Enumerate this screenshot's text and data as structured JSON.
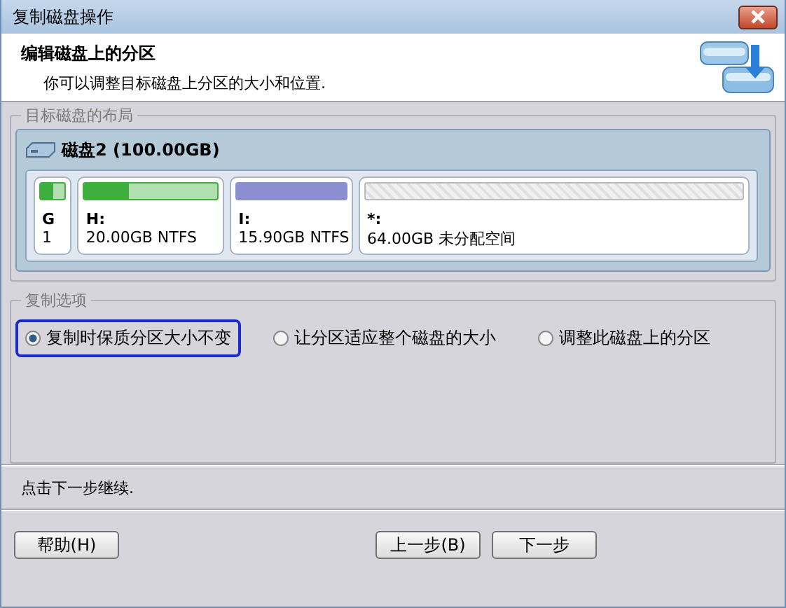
{
  "window": {
    "title": "复制磁盘操作"
  },
  "header": {
    "title": "编辑磁盘上的分区",
    "subtitle": "你可以调整目标磁盘上分区的大小和位置."
  },
  "layout_group": {
    "legend": "目标磁盘的布局",
    "disk_label": "磁盘2 (100.00GB)",
    "partitions": [
      {
        "kind": "used",
        "color": "#3fae3f",
        "level": 0.5,
        "name": "G",
        "info": "1"
      },
      {
        "kind": "used",
        "color": "#3fae3f",
        "level": 0.33,
        "name": "H:",
        "info": "20.00GB NTFS"
      },
      {
        "kind": "used",
        "color": "#8c8fcf",
        "level": 1,
        "name": "I:",
        "info": "15.90GB NTFS"
      },
      {
        "kind": "unallocated",
        "name": "*:",
        "info": "64.00GB 未分配空间"
      }
    ]
  },
  "options_group": {
    "legend": "复制选项",
    "options": [
      {
        "label": "复制时保质分区大小不变",
        "selected": true,
        "focused": true
      },
      {
        "label": "让分区适应整个磁盘的大小",
        "selected": false,
        "focused": false
      },
      {
        "label": "调整此磁盘上的分区",
        "selected": false,
        "focused": false
      }
    ]
  },
  "hint": "点击下一步继续.",
  "buttons": {
    "help": "帮助(H)",
    "back": "上一步(B)",
    "next": "下一步"
  }
}
